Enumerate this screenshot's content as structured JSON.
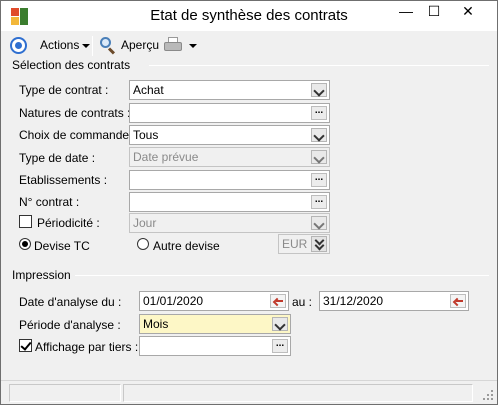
{
  "window": {
    "title": "Etat de synthèse des contrats",
    "controls": {
      "minimize": "—",
      "maximize": "☐",
      "close": "✕"
    }
  },
  "toolbar": {
    "actions_label": "Actions",
    "preview_label": "Aperçu"
  },
  "selection": {
    "section_label": "Sélection des contrats",
    "type_contrat": {
      "label": "Type de contrat :",
      "value": "Achat"
    },
    "natures": {
      "label": "Natures de contrats :",
      "value": ""
    },
    "choix_commande": {
      "label": "Choix de commande :",
      "value": "Tous"
    },
    "type_date": {
      "label": "Type de date :",
      "value": "Date prévue"
    },
    "etablissements": {
      "label": "Etablissements :",
      "value": ""
    },
    "numero_contrat": {
      "label": "N° contrat :",
      "value": ""
    },
    "periodicite": {
      "label": "Périodicité :",
      "value": "Jour",
      "checked": false
    },
    "devise_tc": {
      "label": "Devise TC",
      "selected": true
    },
    "autre_devise": {
      "label": "Autre devise",
      "selected": false,
      "value": "EUR"
    }
  },
  "impression": {
    "section_label": "Impression",
    "date_analyse": {
      "label": "Date d'analyse du :",
      "from": "01/01/2020",
      "to_label": "au :",
      "to": "31/12/2020"
    },
    "periode_analyse": {
      "label": "Période d'analyse :",
      "value": "Mois"
    },
    "affichage_tiers": {
      "label": "Affichage par tiers :",
      "checked": true,
      "value": ""
    }
  },
  "colors": {
    "yellow_field": "#fdf7c6",
    "accent_blue": "#2f6fd0"
  }
}
